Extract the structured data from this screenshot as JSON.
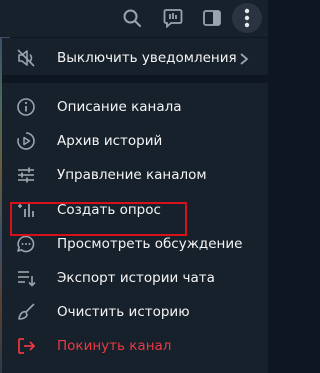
{
  "colors": {
    "menu_bg": "#17212b",
    "text": "#f5f5f5",
    "icon": "#9aa4ae",
    "danger": "#ec3942",
    "highlight": "#d6111b"
  },
  "toolbar": {
    "icons": [
      "search-icon",
      "discussion-icon",
      "side-panel-icon",
      "more-vertical-icon"
    ]
  },
  "menu": {
    "items": [
      {
        "label": "Выключить уведомления",
        "icon": "mute-icon",
        "has_submenu": true
      },
      {
        "label": "Описание канала",
        "icon": "info-icon"
      },
      {
        "label": "Архив историй",
        "icon": "stories-archive-icon"
      },
      {
        "label": "Управление каналом",
        "icon": "settings-sliders-icon"
      },
      {
        "label": "Создать опрос",
        "icon": "poll-icon",
        "highlighted": true
      },
      {
        "label": "Просмотреть обсуждение",
        "icon": "discussion-icon"
      },
      {
        "label": "Экспорт истории чата",
        "icon": "export-icon"
      },
      {
        "label": "Очистить историю",
        "icon": "broom-icon"
      },
      {
        "label": "Покинуть канал",
        "icon": "leave-icon",
        "danger": true
      }
    ]
  }
}
